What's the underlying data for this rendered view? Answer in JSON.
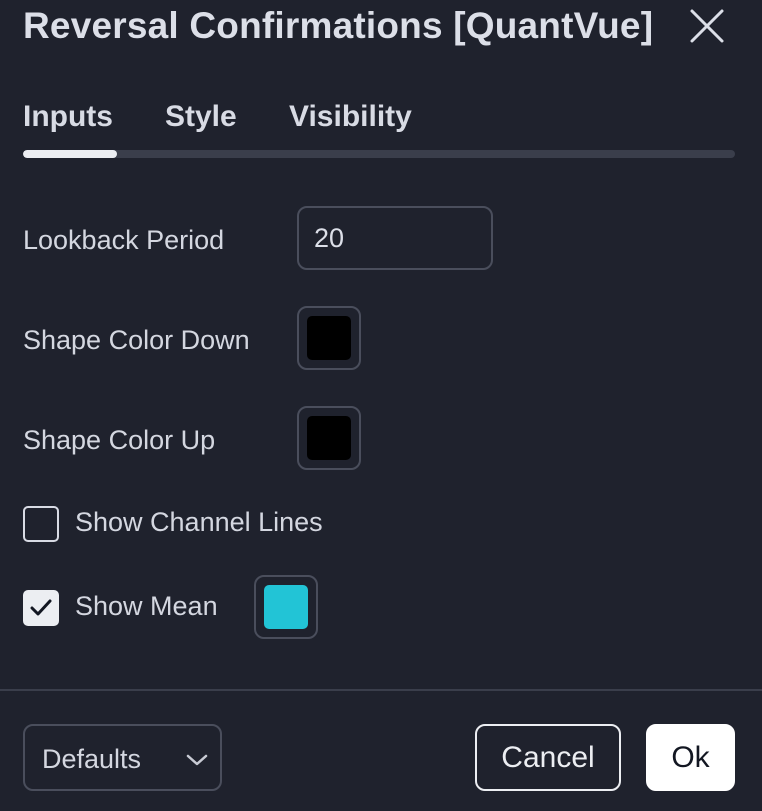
{
  "dialog": {
    "title": "Reversal Confirmations [QuantVue]",
    "close_icon": "close-icon"
  },
  "tabs": [
    {
      "label": "Inputs",
      "active": true
    },
    {
      "label": "Style",
      "active": false
    },
    {
      "label": "Visibility",
      "active": false
    }
  ],
  "inputs": {
    "lookback": {
      "label": "Lookback Period",
      "value": "20"
    },
    "shape_color_down": {
      "label": "Shape Color Down",
      "color": "#000000"
    },
    "shape_color_up": {
      "label": "Shape Color Up",
      "color": "#000000"
    },
    "show_channel_lines": {
      "label": "Show Channel Lines",
      "checked": false
    },
    "show_mean": {
      "label": "Show Mean",
      "checked": true,
      "color": "#22c4d6"
    }
  },
  "footer": {
    "defaults_label": "Defaults",
    "cancel_label": "Cancel",
    "ok_label": "Ok"
  },
  "colors": {
    "background": "#1f222d",
    "text": "#d8dbe4",
    "border": "#4a4e5c",
    "accent_teal": "#22c4d6"
  }
}
